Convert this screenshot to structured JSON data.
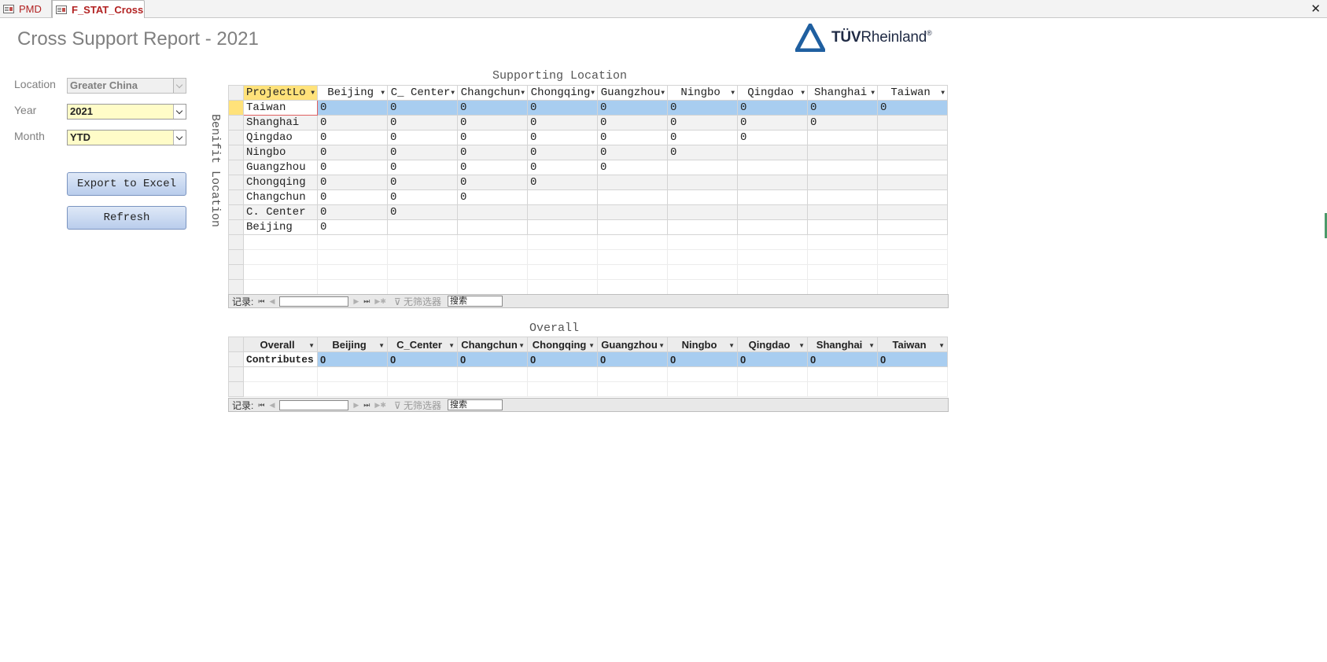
{
  "tabs": [
    {
      "label": "PMD"
    },
    {
      "label": "F_STAT_Cross"
    }
  ],
  "report_title": "Cross Support Report - 2021",
  "logo": {
    "brand_bold": "TÜV",
    "brand_rest": "Rheinland",
    "mark": "®"
  },
  "filters": {
    "location": {
      "label": "Location",
      "value": "Greater China"
    },
    "year": {
      "label": "Year",
      "value": "2021"
    },
    "month": {
      "label": "Month",
      "value": "YTD"
    }
  },
  "buttons": {
    "export": "Export to Excel",
    "refresh": "Refresh"
  },
  "cross_table": {
    "title": "Supporting Location",
    "side_label": "Benifit Location",
    "columns": [
      "ProjectLo",
      "Beijing",
      "C_ Center",
      "Changchun",
      "Chongqing",
      "Guangzhou",
      "Ningbo",
      "Qingdao",
      "Shanghai",
      "Taiwan"
    ],
    "rows": [
      {
        "label": "Taiwan",
        "values": [
          "0",
          "0",
          "0",
          "0",
          "0",
          "0",
          "0",
          "0",
          "0"
        ]
      },
      {
        "label": "Shanghai",
        "values": [
          "0",
          "0",
          "0",
          "0",
          "0",
          "0",
          "0",
          "0",
          ""
        ]
      },
      {
        "label": "Qingdao",
        "values": [
          "0",
          "0",
          "0",
          "0",
          "0",
          "0",
          "0",
          "",
          ""
        ]
      },
      {
        "label": "Ningbo",
        "values": [
          "0",
          "0",
          "0",
          "0",
          "0",
          "0",
          "",
          "",
          ""
        ]
      },
      {
        "label": "Guangzhou",
        "values": [
          "0",
          "0",
          "0",
          "0",
          "0",
          "",
          "",
          "",
          ""
        ]
      },
      {
        "label": "Chongqing",
        "values": [
          "0",
          "0",
          "0",
          "0",
          "",
          "",
          "",
          "",
          ""
        ]
      },
      {
        "label": "Changchun",
        "values": [
          "0",
          "0",
          "0",
          "",
          "",
          "",
          "",
          "",
          ""
        ]
      },
      {
        "label": "C. Center",
        "values": [
          "0",
          "0",
          "",
          "",
          "",
          "",
          "",
          "",
          ""
        ]
      },
      {
        "label": "Beijing",
        "values": [
          "0",
          "",
          "",
          "",
          "",
          "",
          "",
          "",
          ""
        ]
      }
    ]
  },
  "overall_table": {
    "title": "Overall",
    "columns": [
      "Overall",
      "Beijing",
      "C_Center",
      "Changchun",
      "Chongqing",
      "Guangzhou",
      "Ningbo",
      "Qingdao",
      "Shanghai",
      "Taiwan"
    ],
    "rows": [
      {
        "label": "Contributes",
        "values": [
          "0",
          "0",
          "0",
          "0",
          "0",
          "0",
          "0",
          "0",
          "0"
        ]
      }
    ]
  },
  "navigator": {
    "record_label": "记录:",
    "no_filter": "无筛选器",
    "search": "搜索"
  }
}
